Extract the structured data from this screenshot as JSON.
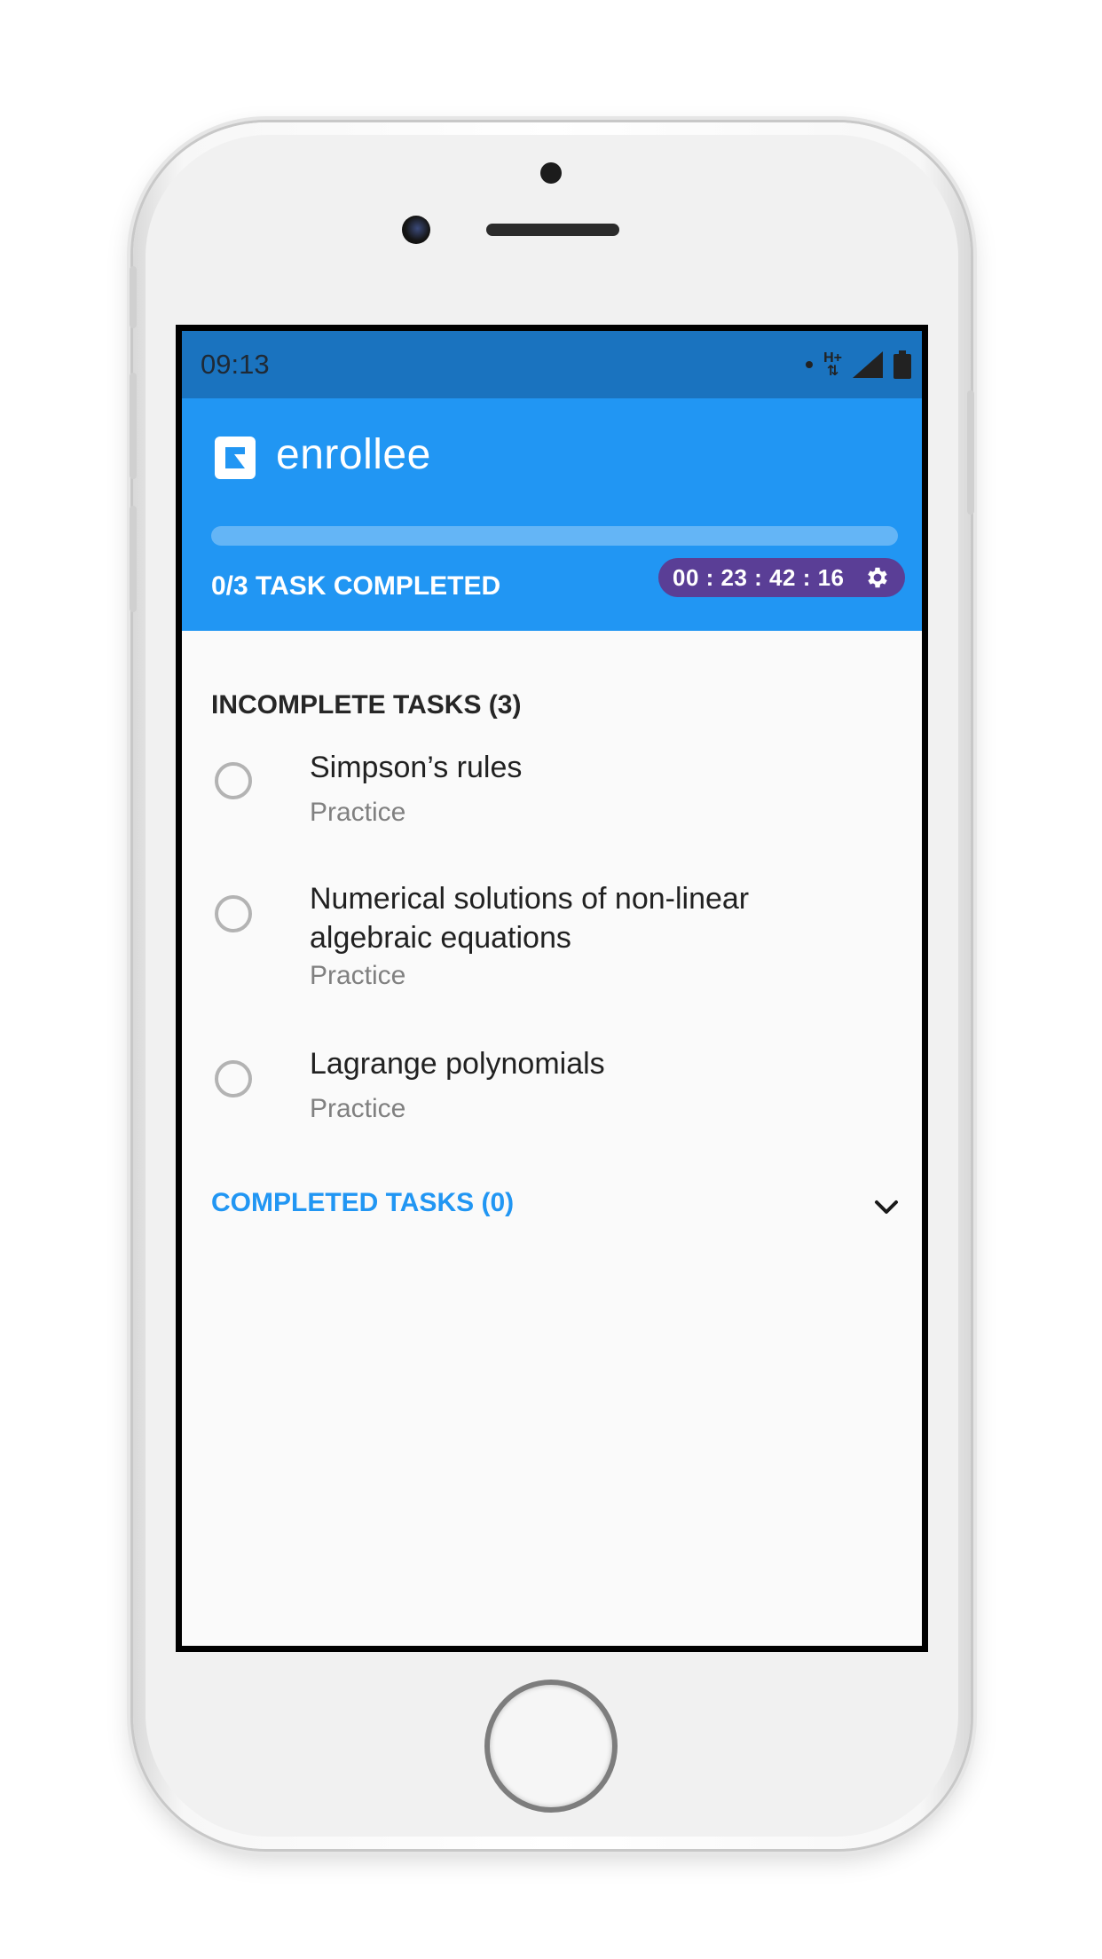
{
  "status_bar": {
    "time": "09:13",
    "network_label": "H+"
  },
  "app_bar": {
    "title": "enrollee",
    "progress_fraction": 0,
    "task_count_label": "0/3 TASK COMPLETED",
    "timer": "00 : 23 : 42 : 16"
  },
  "incomplete_section": {
    "label": "INCOMPLETE TASKS (3)",
    "tasks": [
      {
        "title": "Simpson’s rules",
        "type": "Practice"
      },
      {
        "title": "Numerical solutions of non-linear algebraic equations",
        "type": "Practice"
      },
      {
        "title": "Lagrange polynomials",
        "type": "Practice"
      }
    ]
  },
  "completed_section": {
    "label": "COMPLETED TASKS (0)"
  },
  "colors": {
    "primary": "#2196f3",
    "status_bar": "#1a73bf",
    "timer_badge": "#5a3e96",
    "completed_label": "#2196f3"
  },
  "icons": [
    "logo-icon",
    "gear-icon",
    "chevron-down-icon",
    "radio-unchecked-icon",
    "signal-icon",
    "battery-icon"
  ]
}
